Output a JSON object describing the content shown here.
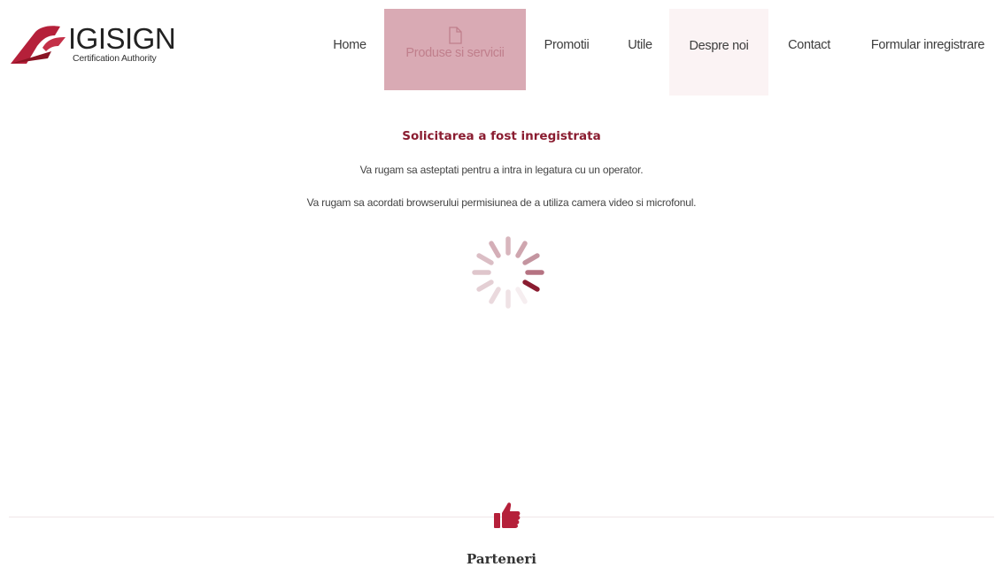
{
  "brand": {
    "logo_text": "IGISIGN",
    "logo_subtitle": "Certification Authority",
    "accent_color": "#b5203a"
  },
  "nav": {
    "items": [
      {
        "label": "Home",
        "state": "normal"
      },
      {
        "label": "Produse si servicii",
        "state": "active",
        "icon": "document-icon"
      },
      {
        "label": "Promotii",
        "state": "normal"
      },
      {
        "label": "Utile",
        "state": "normal"
      },
      {
        "label": "Despre noi",
        "state": "hover"
      },
      {
        "label": "Contact",
        "state": "normal"
      },
      {
        "label": "Formular inregistrare",
        "state": "normal"
      }
    ]
  },
  "main": {
    "title": "Solicitarea a fost inregistrata",
    "message_wait": "Va rugam sa asteptati pentru a intra in legatura cu un operator.",
    "message_permission": "Va rugam sa acordati browserului permisiunea de a utiliza camera video si microfonul.",
    "spinner_icon": "loading-spinner-icon"
  },
  "footer": {
    "section_icon": "thumbs-up-icon",
    "section_title": "Parteneri"
  }
}
